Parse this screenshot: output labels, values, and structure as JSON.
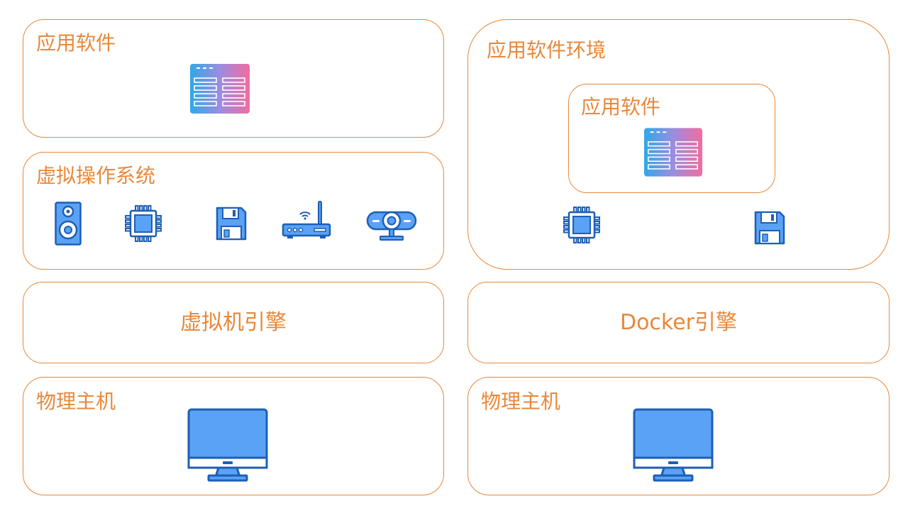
{
  "left_stack": {
    "app_software": {
      "label": "应用软件",
      "icon": "app-window-icon"
    },
    "virtual_os": {
      "label": "虚拟操作系统",
      "icons": [
        "speaker-icon",
        "cpu-chip-icon",
        "floppy-disk-icon",
        "router-icon",
        "webcam-icon"
      ]
    },
    "vm_engine": {
      "label": "虚拟机引擎"
    },
    "physical_host": {
      "label": "物理主机",
      "icon": "monitor-icon"
    }
  },
  "right_stack": {
    "app_environment": {
      "label": "应用软件环境",
      "inner_app": {
        "label": "应用软件",
        "icon": "app-window-icon"
      },
      "icons": [
        "cpu-chip-icon",
        "floppy-disk-icon"
      ]
    },
    "docker_engine": {
      "label": "Docker引擎"
    },
    "physical_host": {
      "label": "物理主机",
      "icon": "monitor-icon"
    }
  },
  "colors": {
    "border": "#e8883a",
    "label": "#e8883a",
    "icon_stroke": "#1d5fb5",
    "icon_fill": "#5aa2f5",
    "gradient_start": "#2fa8ea",
    "gradient_end": "#f26c9e"
  }
}
